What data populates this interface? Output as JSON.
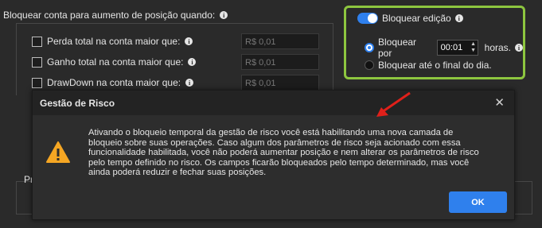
{
  "section": {
    "title": "Bloquear conta para aumento de posição quando:",
    "rows": [
      {
        "label": "Perda total na conta maior que:",
        "value": "R$ 0,01"
      },
      {
        "label": "Ganho total na conta maior que:",
        "value": "R$ 0,01"
      },
      {
        "label": "DrawDown na conta maior que:",
        "value": "R$ 0,01"
      }
    ]
  },
  "lock": {
    "toggle_label": "Bloquear edição",
    "option1_prefix": "Bloquear por",
    "time_value": "00:01",
    "option1_suffix": "horas.",
    "option2_label": "Bloquear até o final do dia."
  },
  "truncated_label": "Pr",
  "dialog": {
    "title": "Gestão de Risco",
    "message": "Ativando o bloqueio temporal da gestão de risco você está habilitando uma nova camada de bloqueio sobre suas operações. Caso algum dos parâmetros de risco seja acionado com essa funcionalidade habilitada, você não poderá aumentar posição e nem alterar os parâmetros de risco pelo tempo definido no risco. Os campos ficarão bloqueados pelo tempo determinado, mas você ainda poderá reduzir e fechar suas posições.",
    "ok_label": "OK"
  },
  "colors": {
    "accent": "#2f80ed",
    "highlight": "#8dc63f",
    "arrow": "#e0201a",
    "warning": "#f5a623"
  }
}
